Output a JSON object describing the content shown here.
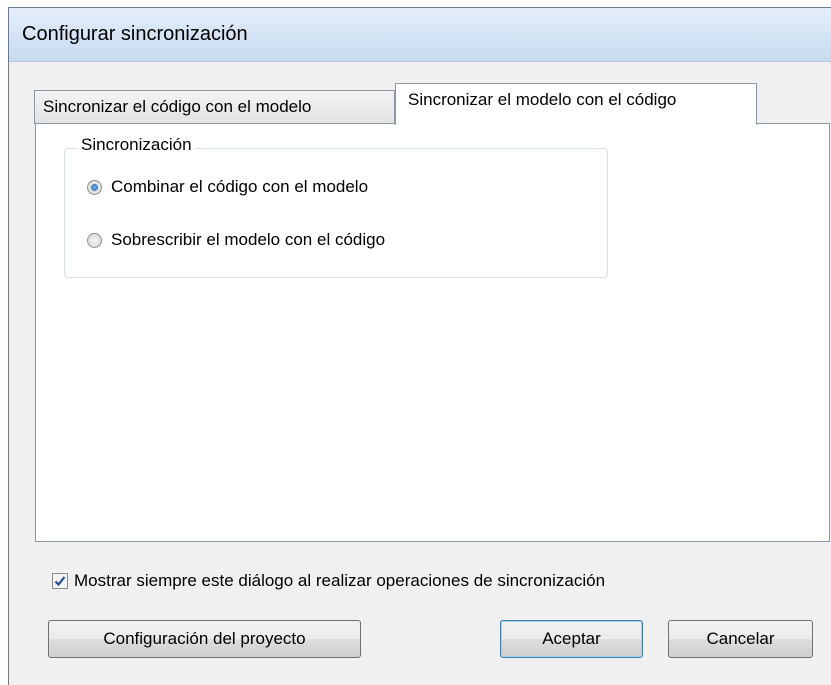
{
  "window": {
    "title": "Configurar sincronización"
  },
  "tabs": [
    {
      "label": "Sincronizar el código con el modelo",
      "active": false
    },
    {
      "label": "Sincronizar el modelo con el código",
      "active": true
    }
  ],
  "group": {
    "legend": "Sincronización",
    "options": [
      {
        "label": "Combinar el código con el modelo",
        "checked": true
      },
      {
        "label": "Sobrescribir el modelo con el código",
        "checked": false
      }
    ]
  },
  "always_show": {
    "label": "Mostrar siempre este diálogo al realizar operaciones de sincronización",
    "checked": true
  },
  "buttons": {
    "project_settings": "Configuración del proyecto",
    "ok": "Aceptar",
    "cancel": "Cancelar"
  },
  "colors": {
    "titlebar": "#c7daf0",
    "dialog_bg": "#f0f0f0",
    "check_mark": "#1f4f8f",
    "radio_dot": "#1c5fa8"
  }
}
